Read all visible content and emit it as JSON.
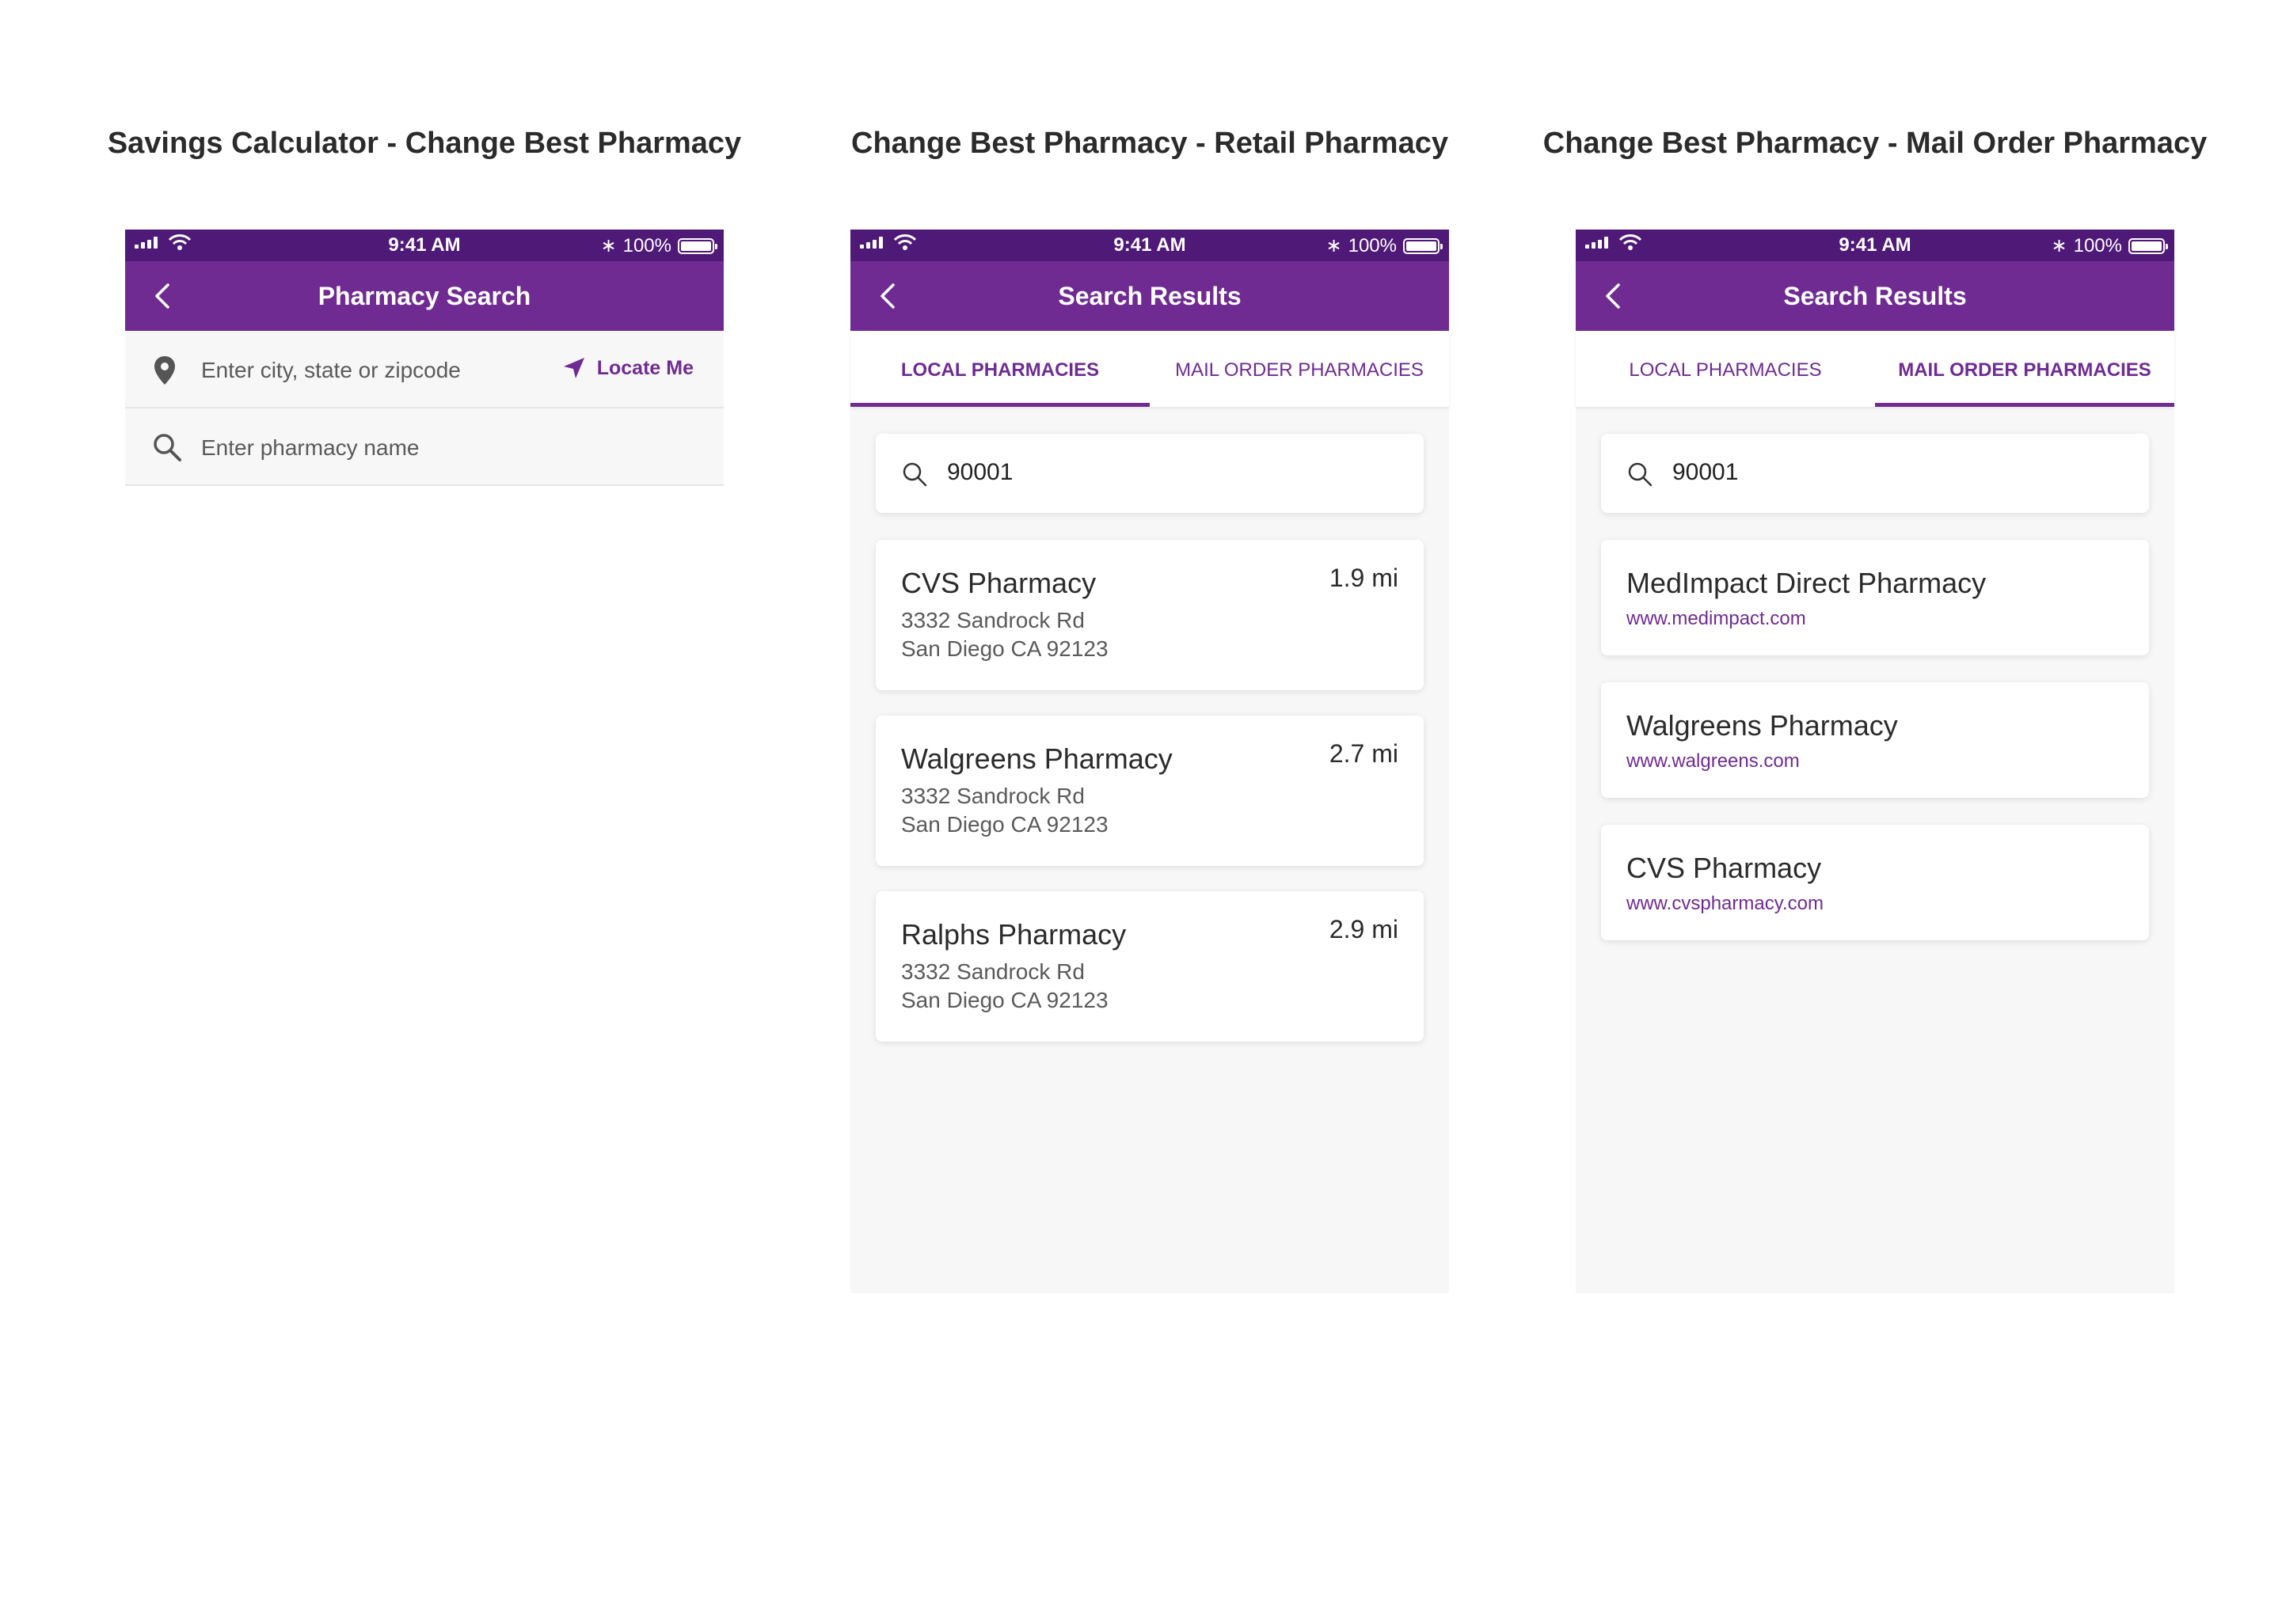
{
  "artboards": [
    {
      "title": "Savings Calculator - Change Best Pharmacy"
    },
    {
      "title": "Change Best Pharmacy - Retail Pharmacy"
    },
    {
      "title": "Change Best Pharmacy - Mail Order Pharmacy"
    }
  ],
  "status": {
    "time": "9:41 AM",
    "battery": "100%"
  },
  "colors": {
    "primary": "#6f2b92",
    "status_bar": "#4f1978",
    "background": "#f7f7f7"
  },
  "pharmacy_search": {
    "title": "Pharmacy Search",
    "location_placeholder": "Enter city, state or zipcode",
    "locate_label": "Locate Me",
    "name_placeholder": "Enter pharmacy name"
  },
  "results_title": "Search Results",
  "tabs": [
    "LOCAL PHARMACIES",
    "MAIL ORDER PHARMACIES"
  ],
  "query": "90001",
  "local_results": [
    {
      "name": "CVS Pharmacy",
      "distance": "1.9 mi",
      "street": "3332 Sandrock Rd",
      "city": "San Diego CA 92123"
    },
    {
      "name": "Walgreens Pharmacy",
      "distance": "2.7 mi",
      "street": "3332 Sandrock Rd",
      "city": "San Diego CA 92123"
    },
    {
      "name": "Ralphs Pharmacy",
      "distance": "2.9 mi",
      "street": "3332 Sandrock Rd",
      "city": "San Diego CA 92123"
    }
  ],
  "mail_results": [
    {
      "name": "MedImpact Direct Pharmacy",
      "url": "www.medimpact.com"
    },
    {
      "name": "Walgreens Pharmacy",
      "url": "www.walgreens.com"
    },
    {
      "name": "CVS Pharmacy",
      "url": "www.cvspharmacy.com"
    }
  ]
}
